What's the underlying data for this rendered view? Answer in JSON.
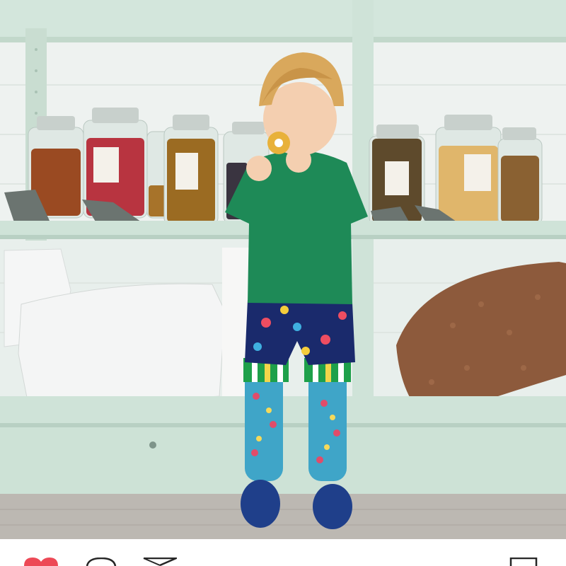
{
  "post": {
    "photo_subject": "child-with-cookie-in-bulk-food-store",
    "jar_labels": [
      "",
      "",
      "",
      "",
      ""
    ]
  },
  "actions": {
    "like_icon": "heart-icon",
    "comment_icon": "comment-bubble-icon",
    "share_icon": "paper-plane-icon",
    "save_icon": "bookmark-icon",
    "liked": true
  },
  "colors": {
    "heart": "#ed4956",
    "icon": "#262626",
    "shelf": "#cfe3d8",
    "sweater": "#1e8a57"
  }
}
